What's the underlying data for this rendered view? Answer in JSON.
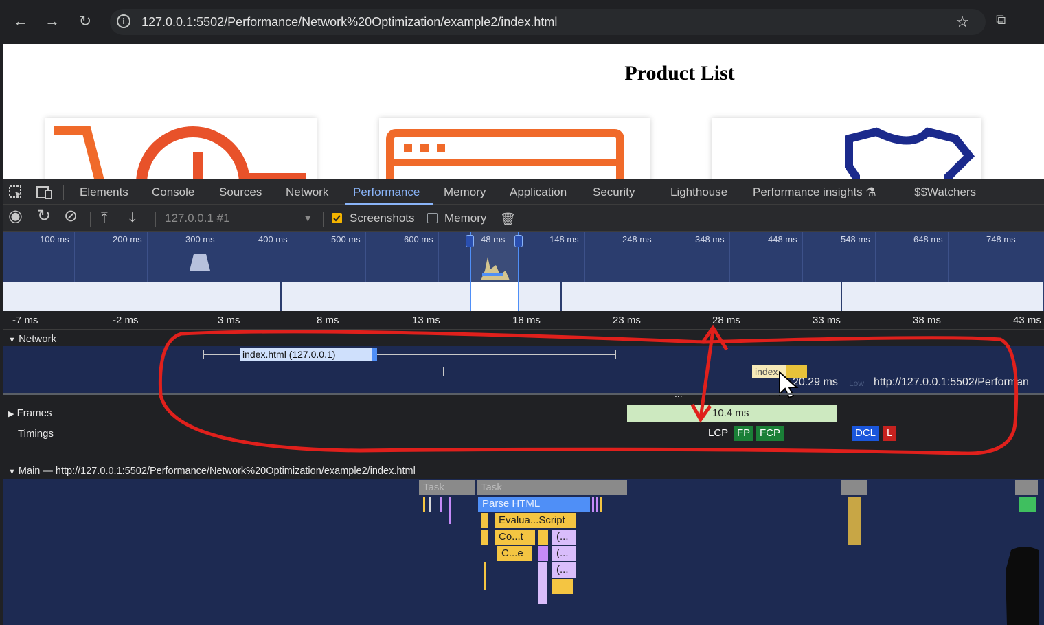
{
  "browser": {
    "url": "127.0.0.1:5502/Performance/Network%20Optimization/example2/index.html",
    "back_icon": "←",
    "forward_icon": "→",
    "reload_icon": "↻",
    "info_icon": "i",
    "star_icon": "☆",
    "extensions_icon": "⧉"
  },
  "page": {
    "title": "Product List"
  },
  "devtools": {
    "tabs": [
      "Elements",
      "Console",
      "Sources",
      "Network",
      "Performance",
      "Memory",
      "Application",
      "Security",
      "Lighthouse",
      "Performance insights",
      "$$Watchers"
    ],
    "active_tab": "Performance",
    "insights_icon": "⚗",
    "toolbar": {
      "record_icon": "◉",
      "reload_icon": "↻",
      "clear_icon": "⊘",
      "upload_icon": "⤒",
      "download_icon": "⤓",
      "target": "127.0.0.1 #1",
      "dropdown_icon": "▾",
      "screenshots_label": "Screenshots",
      "screenshots_checked": true,
      "memory_label": "Memory",
      "memory_checked": false,
      "trash_icon": "🗑"
    },
    "overview_ticks": [
      "100 ms",
      "200 ms",
      "300 ms",
      "400 ms",
      "500 ms",
      "600 ms",
      "48 ms",
      "148 ms",
      "248 ms",
      "348 ms",
      "448 ms",
      "548 ms",
      "648 ms",
      "748 ms"
    ],
    "ruler_ticks": [
      "-7 ms",
      "-2 ms",
      "3 ms",
      "8 ms",
      "13 ms",
      "18 ms",
      "23 ms",
      "28 ms",
      "33 ms",
      "38 ms",
      "43 ms"
    ],
    "network_track": {
      "label": "Network",
      "request1": "index.html (127.0.0.1)",
      "request2": "index.",
      "tooltip_time": "20.29 ms",
      "tooltip_priority": "Low",
      "tooltip_url": "http://127.0.0.1:5502/Performan"
    },
    "frames_track": {
      "label": "Frames",
      "frame_duration": "10.4 ms"
    },
    "timings_track": {
      "label": "Timings",
      "markers": [
        "LCP",
        "FP",
        "FCP",
        "DCL",
        "L"
      ]
    },
    "main_track": {
      "label": "Main — http://127.0.0.1:5502/Performance/Network%20Optimization/example2/index.html",
      "task1": "Task",
      "task2": "Task",
      "parse_html": "Parse HTML",
      "evaluate_script": "Evalua...Script",
      "compile1": "Co...t",
      "compile2": "C...e",
      "anon1": "(...",
      "anon2": "(...",
      "anon3": "(..."
    },
    "ellipsis": "..."
  },
  "colors": {
    "annotation": "#e0201c",
    "accent": "#8ab4f8",
    "network_request": "#cfe0fc",
    "frame": "#cde9c0",
    "lcp_fp_fcp": "#1a7f37",
    "dcl": "#1a56db",
    "load": "#c5221f"
  }
}
